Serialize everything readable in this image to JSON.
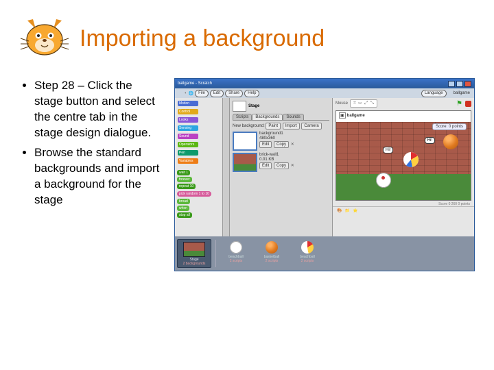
{
  "title": "Importing a background",
  "bullets": [
    "Step 28 – Click the stage button and select the centre tab in the stage design dialogue.",
    "Browse the standard backgrounds and import a background for the stage"
  ],
  "screenshot": {
    "window_title": "ballgame - Scratch",
    "menu": [
      "File",
      "Edit",
      "Share",
      "Help"
    ],
    "menu_right": [
      "Language"
    ],
    "project_label": "ballgame",
    "palette": {
      "cats": [
        {
          "label": "Motion",
          "color": "#4a6cd4"
        },
        {
          "label": "Looks",
          "color": "#8a55d7"
        },
        {
          "label": "Control",
          "color": "#e1a91a"
        },
        {
          "label": "Sound",
          "color": "#bb42c3"
        },
        {
          "label": "Sensing",
          "color": "#2ca5e2"
        },
        {
          "label": "Pen",
          "color": "#0e9a6c"
        },
        {
          "label": "Operators",
          "color": "#5cb712"
        },
        {
          "label": "Variables",
          "color": "#ee7d16"
        }
      ],
      "rand_block": "pick random 1 to 10",
      "blocks": [
        "wait 1",
        "forever",
        "repeat 10",
        "broad",
        "when",
        "stop all"
      ]
    },
    "mid": {
      "sprite_name": "Stage",
      "tabs": [
        "Scripts",
        "Backgrounds",
        "Sounds"
      ],
      "active_tab": 1,
      "section_label": "New background:",
      "btn_paint": "Paint",
      "btn_import": "Import",
      "btn_camera": "Camera",
      "bg1_name": "background1",
      "bg1_size": "480x360",
      "bg2_name": "brick-wall1",
      "bg2_size": "0.01 KB",
      "btn_edit": "Edit",
      "btn_copy": "Copy"
    },
    "stage": {
      "mouse": "Mouse",
      "canvas_title": "ballgame",
      "score_label": "Score: 0 points",
      "bubble1": "Hi!",
      "bubble2": "Hi!",
      "meta": "Score 0  260\n0 points"
    },
    "strip": {
      "stage_label": "Stage",
      "stage_sub": "2 backgrounds",
      "sprites": [
        {
          "name": "beachball",
          "sub": "2 scripts",
          "kind": "soccer"
        },
        {
          "name": "basketball",
          "sub": "2 scripts",
          "kind": "basket"
        },
        {
          "name": "beachball",
          "sub": "2 scripts",
          "kind": "beach"
        }
      ]
    }
  }
}
